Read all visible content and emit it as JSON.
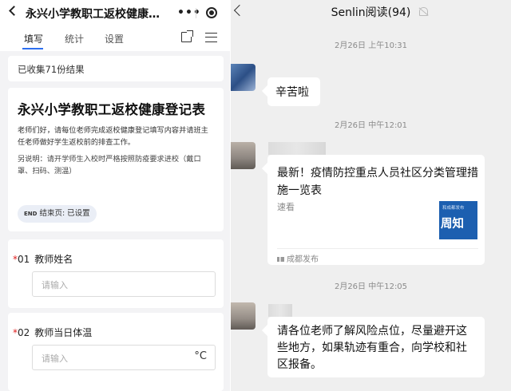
{
  "left": {
    "title": "永兴小学教职工返校健康登记...",
    "menu_dots": "•••",
    "tabs": [
      {
        "label": "填写",
        "active": true
      },
      {
        "label": "统计",
        "active": false
      },
      {
        "label": "设置",
        "active": false
      }
    ],
    "collected": "已收集71份结果",
    "form": {
      "title": "永兴小学教职工返校健康登记表",
      "description": "老师们好，请每位老师完成返校健康登记填写内容并请班主任老师做好学生返校前的排查工作。",
      "note": "另说明：请开学师生入校时严格按照防疫要求进校（戴口罩、扫码、测温）",
      "end_tag_icon": "END",
      "end_tag_label": "结束页: 已设置"
    },
    "questions": [
      {
        "required": "*",
        "number": "01",
        "label": "教师姓名",
        "placeholder": "请输入",
        "unit": ""
      },
      {
        "required": "*",
        "number": "02",
        "label": "教师当日体温",
        "placeholder": "请输入",
        "unit": "°C"
      }
    ]
  },
  "right": {
    "title": "Senlin阅读(94)",
    "messages": [
      {
        "time": "2月26日 上午10:31",
        "text": "辛苦啦"
      },
      {
        "time": "2月26日 中午12:01",
        "link_title": "最新！疫情防控重点人员社区分类管理措施一览表",
        "link_desc": "速看",
        "thumb_top": "和成都发布",
        "thumb_text": "周知",
        "source": "成都发布"
      },
      {
        "time": "2月26日 中午12:05",
        "text": "请各位老师了解风险点位，尽量避开这些地方，如果轨迹有重合，向学校和社区报备。"
      }
    ]
  },
  "colors": {
    "tab_accent": "#2d6ff0",
    "required": "#e02020",
    "thumb_blue": "#1c5fb0"
  }
}
